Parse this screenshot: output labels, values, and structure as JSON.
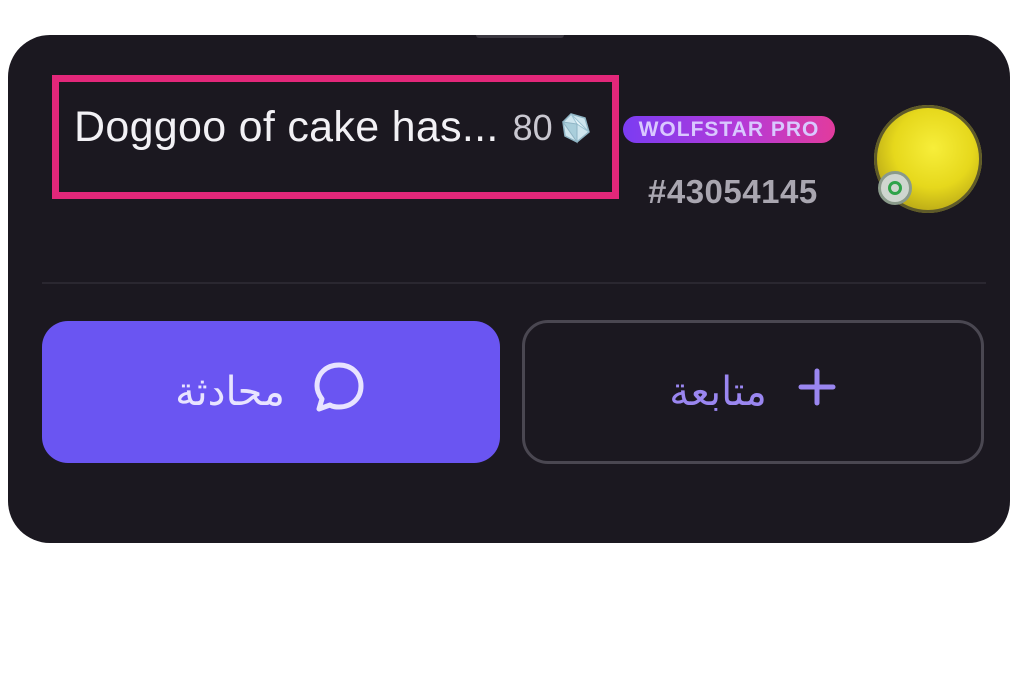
{
  "profile": {
    "name": "Doggoo of cake has...",
    "level": "80",
    "level_icon": "diamond-icon",
    "badge": "WOLFSTAR PRO",
    "user_id": "#43054145",
    "avatar_status_icon": "online-status-icon"
  },
  "actions": {
    "chat_label": "محادثة",
    "chat_icon": "chat-bubble-icon",
    "follow_label": "متابعة",
    "follow_icon": "plus-icon"
  },
  "colors": {
    "card_background": "#1b1820",
    "highlight": "#e3277a",
    "chat_button": "#6a55f2",
    "badge_gradient_start": "#7b3cf2",
    "badge_gradient_end": "#e23b9d"
  }
}
